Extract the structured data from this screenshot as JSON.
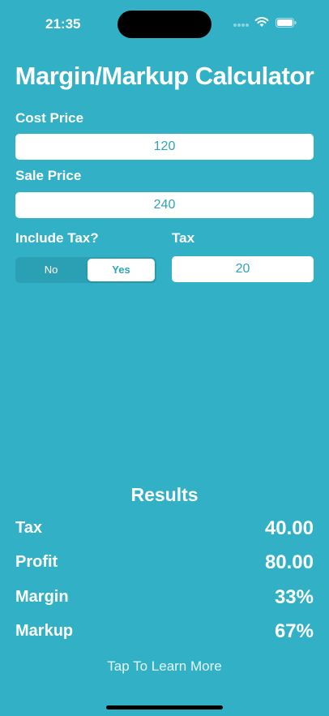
{
  "status_bar": {
    "time": "21:35"
  },
  "app": {
    "title": "Margin/Markup Calculator"
  },
  "form": {
    "cost_label": "Cost Price",
    "cost_value": "120",
    "sale_label": "Sale Price",
    "sale_value": "240",
    "include_tax_label": "Include Tax?",
    "tax_options": [
      "No",
      "Yes"
    ],
    "tax_selected": "Yes",
    "tax_label": "Tax",
    "tax_value": "20"
  },
  "results": {
    "title": "Results",
    "rows": [
      {
        "label": "Tax",
        "value": "40.00"
      },
      {
        "label": "Profit",
        "value": "80.00"
      },
      {
        "label": "Margin",
        "value": "33%"
      },
      {
        "label": "Markup",
        "value": "67%"
      }
    ]
  },
  "learn_more": "Tap To Learn More",
  "colors": {
    "background": "#31b0c6",
    "accent_text": "#2fa3bd"
  }
}
